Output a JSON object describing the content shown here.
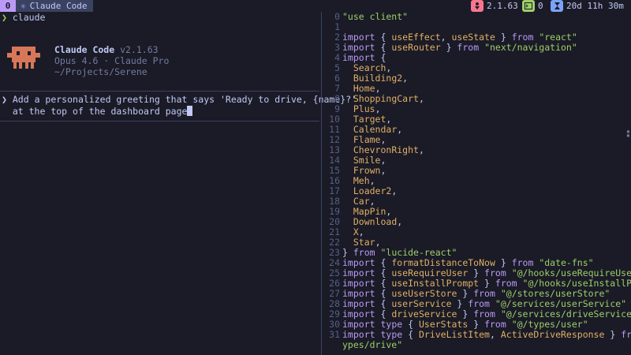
{
  "topbar": {
    "workspace": "0",
    "window_title": "Claude Code",
    "title_glyph": "✳",
    "version": "2.1.63",
    "count": "0",
    "uptime": "20d 11h 30m",
    "colors": {
      "pink": "#f7768e",
      "green": "#9ece6a",
      "blue": "#7aa2f7",
      "purple": "#bb9af7"
    }
  },
  "terminal": {
    "prompt_symbol": "❯",
    "command": "claude"
  },
  "welcome": {
    "app_name": "Claude Code",
    "version": "v2.1.63",
    "model": "Opus 4.6 · Claude Pro",
    "path": "~/Projects/Serene"
  },
  "input": {
    "line1": "Add a personalized greeting that says 'Ready to drive, {name}?'",
    "line2": "at the top of the dashboard page"
  },
  "code": [
    {
      "n": "0",
      "parts": [
        [
          "str",
          "\"use client\""
        ]
      ]
    },
    {
      "n": "1",
      "parts": []
    },
    {
      "n": "2",
      "parts": [
        [
          "kw",
          "import"
        ],
        [
          "pl",
          " { "
        ],
        [
          "id",
          "useEffect"
        ],
        [
          "pl",
          ", "
        ],
        [
          "id",
          "useState"
        ],
        [
          "pl",
          " } "
        ],
        [
          "kw",
          "from"
        ],
        [
          "pl",
          " "
        ],
        [
          "str",
          "\"react\""
        ]
      ]
    },
    {
      "n": "3",
      "parts": [
        [
          "kw",
          "import"
        ],
        [
          "pl",
          " { "
        ],
        [
          "id",
          "useRouter"
        ],
        [
          "pl",
          " } "
        ],
        [
          "kw",
          "from"
        ],
        [
          "pl",
          " "
        ],
        [
          "str",
          "\"next/navigation\""
        ]
      ]
    },
    {
      "n": "4",
      "parts": [
        [
          "kw",
          "import"
        ],
        [
          "pl",
          " {"
        ]
      ]
    },
    {
      "n": "5",
      "parts": [
        [
          "pl",
          "  "
        ],
        [
          "id",
          "Search"
        ],
        [
          "pl",
          ","
        ]
      ]
    },
    {
      "n": "6",
      "parts": [
        [
          "pl",
          "  "
        ],
        [
          "id",
          "Building2"
        ],
        [
          "pl",
          ","
        ]
      ]
    },
    {
      "n": "7",
      "parts": [
        [
          "pl",
          "  "
        ],
        [
          "id",
          "Home"
        ],
        [
          "pl",
          ","
        ]
      ]
    },
    {
      "n": "8",
      "parts": [
        [
          "pl",
          "  "
        ],
        [
          "id",
          "ShoppingCart"
        ],
        [
          "pl",
          ","
        ]
      ]
    },
    {
      "n": "9",
      "parts": [
        [
          "pl",
          "  "
        ],
        [
          "id",
          "Plus"
        ],
        [
          "pl",
          ","
        ]
      ]
    },
    {
      "n": "10",
      "parts": [
        [
          "pl",
          "  "
        ],
        [
          "id",
          "Target"
        ],
        [
          "pl",
          ","
        ]
      ]
    },
    {
      "n": "11",
      "parts": [
        [
          "pl",
          "  "
        ],
        [
          "id",
          "Calendar"
        ],
        [
          "pl",
          ","
        ]
      ]
    },
    {
      "n": "12",
      "parts": [
        [
          "pl",
          "  "
        ],
        [
          "id",
          "Flame"
        ],
        [
          "pl",
          ","
        ]
      ]
    },
    {
      "n": "13",
      "parts": [
        [
          "pl",
          "  "
        ],
        [
          "id",
          "ChevronRight"
        ],
        [
          "pl",
          ","
        ]
      ]
    },
    {
      "n": "14",
      "parts": [
        [
          "pl",
          "  "
        ],
        [
          "id",
          "Smile"
        ],
        [
          "pl",
          ","
        ]
      ]
    },
    {
      "n": "15",
      "parts": [
        [
          "pl",
          "  "
        ],
        [
          "id",
          "Frown"
        ],
        [
          "pl",
          ","
        ]
      ]
    },
    {
      "n": "16",
      "parts": [
        [
          "pl",
          "  "
        ],
        [
          "id",
          "Meh"
        ],
        [
          "pl",
          ","
        ]
      ]
    },
    {
      "n": "17",
      "parts": [
        [
          "pl",
          "  "
        ],
        [
          "id",
          "Loader2"
        ],
        [
          "pl",
          ","
        ]
      ]
    },
    {
      "n": "18",
      "parts": [
        [
          "pl",
          "  "
        ],
        [
          "id",
          "Car"
        ],
        [
          "pl",
          ","
        ]
      ]
    },
    {
      "n": "19",
      "parts": [
        [
          "pl",
          "  "
        ],
        [
          "id",
          "MapPin"
        ],
        [
          "pl",
          ","
        ]
      ]
    },
    {
      "n": "20",
      "parts": [
        [
          "pl",
          "  "
        ],
        [
          "id",
          "Download"
        ],
        [
          "pl",
          ","
        ]
      ]
    },
    {
      "n": "21",
      "parts": [
        [
          "pl",
          "  "
        ],
        [
          "id",
          "X"
        ],
        [
          "pl",
          ","
        ]
      ]
    },
    {
      "n": "22",
      "parts": [
        [
          "pl",
          "  "
        ],
        [
          "id",
          "Star"
        ],
        [
          "pl",
          ","
        ]
      ]
    },
    {
      "n": "23",
      "parts": [
        [
          "pl",
          "} "
        ],
        [
          "kw",
          "from"
        ],
        [
          "pl",
          " "
        ],
        [
          "str",
          "\"lucide-react\""
        ]
      ]
    },
    {
      "n": "24",
      "parts": [
        [
          "kw",
          "import"
        ],
        [
          "pl",
          " { "
        ],
        [
          "id",
          "formatDistanceToNow"
        ],
        [
          "pl",
          " } "
        ],
        [
          "kw",
          "from"
        ],
        [
          "pl",
          " "
        ],
        [
          "str",
          "\"date-fns\""
        ]
      ]
    },
    {
      "n": "25",
      "parts": [
        [
          "kw",
          "import"
        ],
        [
          "pl",
          " { "
        ],
        [
          "id",
          "useRequireUser"
        ],
        [
          "pl",
          " } "
        ],
        [
          "kw",
          "from"
        ],
        [
          "pl",
          " "
        ],
        [
          "str",
          "\"@/hooks/useRequireUser\""
        ]
      ]
    },
    {
      "n": "26",
      "parts": [
        [
          "kw",
          "import"
        ],
        [
          "pl",
          " { "
        ],
        [
          "id",
          "useInstallPrompt"
        ],
        [
          "pl",
          " } "
        ],
        [
          "kw",
          "from"
        ],
        [
          "pl",
          " "
        ],
        [
          "str",
          "\"@/hooks/useInstallPrompt\""
        ]
      ]
    },
    {
      "n": "27",
      "parts": [
        [
          "kw",
          "import"
        ],
        [
          "pl",
          " { "
        ],
        [
          "id",
          "useUserStore"
        ],
        [
          "pl",
          " } "
        ],
        [
          "kw",
          "from"
        ],
        [
          "pl",
          " "
        ],
        [
          "str",
          "\"@/stores/userStore\""
        ]
      ]
    },
    {
      "n": "28",
      "parts": [
        [
          "kw",
          "import"
        ],
        [
          "pl",
          " { "
        ],
        [
          "id",
          "userService"
        ],
        [
          "pl",
          " } "
        ],
        [
          "kw",
          "from"
        ],
        [
          "pl",
          " "
        ],
        [
          "str",
          "\"@/services/userService\""
        ]
      ]
    },
    {
      "n": "29",
      "parts": [
        [
          "kw",
          "import"
        ],
        [
          "pl",
          " { "
        ],
        [
          "id",
          "driveService"
        ],
        [
          "pl",
          " } "
        ],
        [
          "kw",
          "from"
        ],
        [
          "pl",
          " "
        ],
        [
          "str",
          "\"@/services/driveService\""
        ]
      ]
    },
    {
      "n": "30",
      "parts": [
        [
          "kw",
          "import"
        ],
        [
          "pl",
          " "
        ],
        [
          "kw",
          "type"
        ],
        [
          "pl",
          " { "
        ],
        [
          "id",
          "UserStats"
        ],
        [
          "pl",
          " } "
        ],
        [
          "kw",
          "from"
        ],
        [
          "pl",
          " "
        ],
        [
          "str",
          "\"@/types/user\""
        ]
      ]
    },
    {
      "n": "31",
      "parts": [
        [
          "kw",
          "import"
        ],
        [
          "pl",
          " "
        ],
        [
          "kw",
          "type"
        ],
        [
          "pl",
          " { "
        ],
        [
          "id",
          "DriveListItem"
        ],
        [
          "pl",
          ", "
        ],
        [
          "id",
          "ActiveDriveResponse"
        ],
        [
          "pl",
          " } "
        ],
        [
          "kw",
          "from"
        ],
        [
          "pl",
          " "
        ],
        [
          "str",
          "\"@/t"
        ]
      ]
    },
    {
      "n": "",
      "parts": [
        [
          "str",
          "ypes/drive\""
        ]
      ]
    }
  ]
}
